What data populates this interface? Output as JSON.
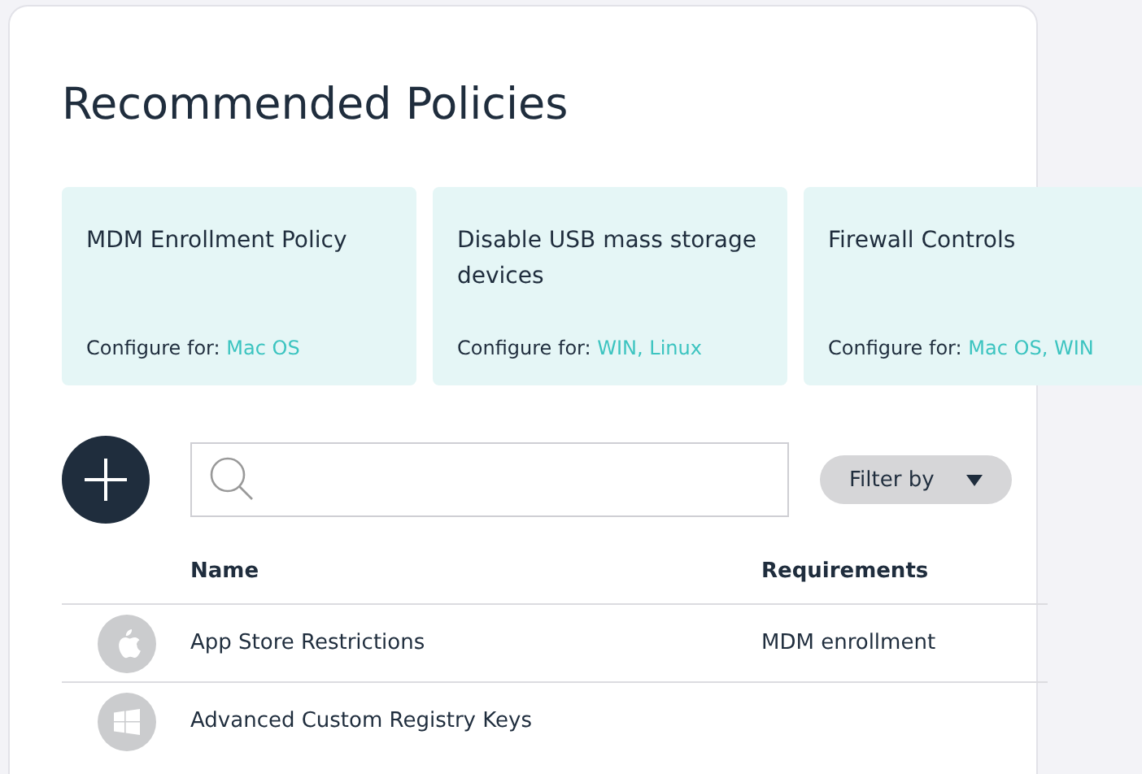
{
  "title": "Recommended Policies",
  "recommended": [
    {
      "name": "MDM Enrollment Policy",
      "configure_label": "Configure for:",
      "platforms": "Mac OS"
    },
    {
      "name": "Disable USB mass storage devices",
      "configure_label": "Configure for:",
      "platforms": "WIN, Linux"
    },
    {
      "name": "Firewall Controls",
      "configure_label": "Configure for:",
      "platforms": "Mac OS, WIN"
    }
  ],
  "filter": {
    "label": "Filter by"
  },
  "table": {
    "columns": [
      "Name",
      "Requirements"
    ],
    "rows": [
      {
        "kind": "apple",
        "name": "App Store Restrictions",
        "requirements": "MDM enrollment"
      },
      {
        "kind": "windows",
        "name": "Advanced Custom Registry Keys"
      }
    ]
  }
}
